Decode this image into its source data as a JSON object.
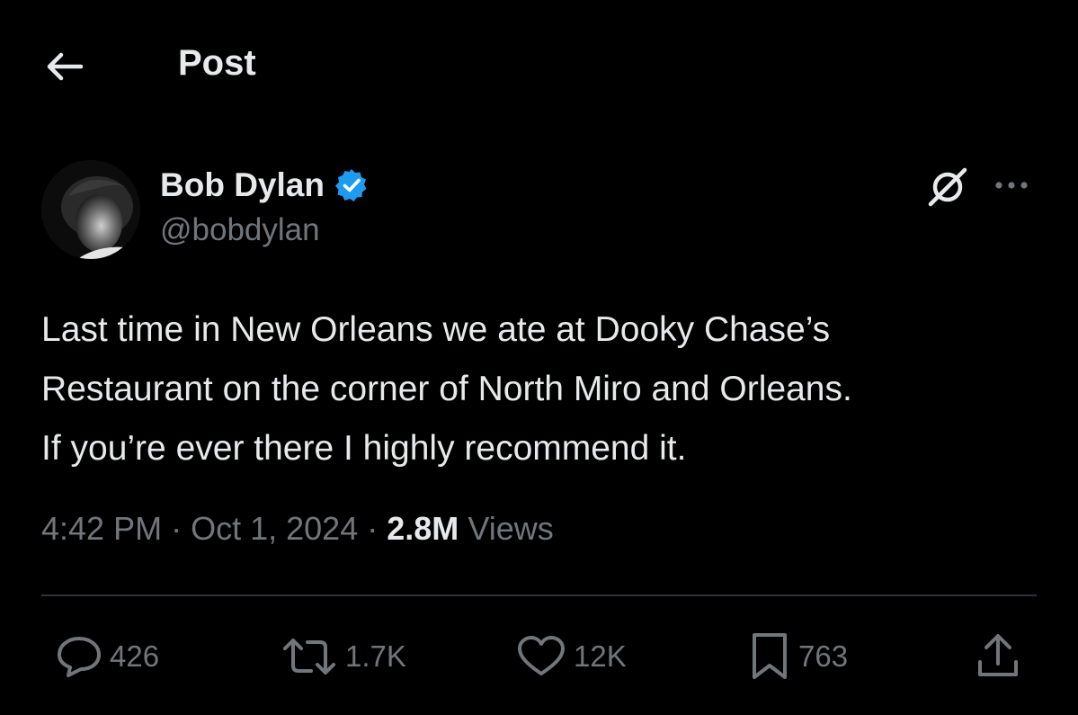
{
  "header": {
    "title": "Post"
  },
  "post": {
    "author": {
      "display_name": "Bob Dylan",
      "handle": "@bobdylan",
      "verified": true
    },
    "text": "Last time in New Orleans we ate at Dooky Chase’s\nRestaurant on the corner of North Miro and Orleans.\nIf you’re ever there I highly recommend it.",
    "time": "4:42 PM",
    "date": "Oct 1, 2024",
    "views_count": "2.8M",
    "views_label": "Views",
    "separator": "·"
  },
  "actions": {
    "replies": "426",
    "reposts": "1.7K",
    "likes": "12K",
    "bookmarks": "763"
  },
  "colors": {
    "background": "#000000",
    "text": "#e7e9ea",
    "muted": "#71767b",
    "verified": "#1d9bf0",
    "divider": "#2f3336"
  },
  "icons": [
    "back-arrow-icon",
    "verified-badge-icon",
    "grok-icon",
    "more-icon",
    "reply-icon",
    "repost-icon",
    "like-icon",
    "bookmark-icon",
    "share-icon"
  ]
}
